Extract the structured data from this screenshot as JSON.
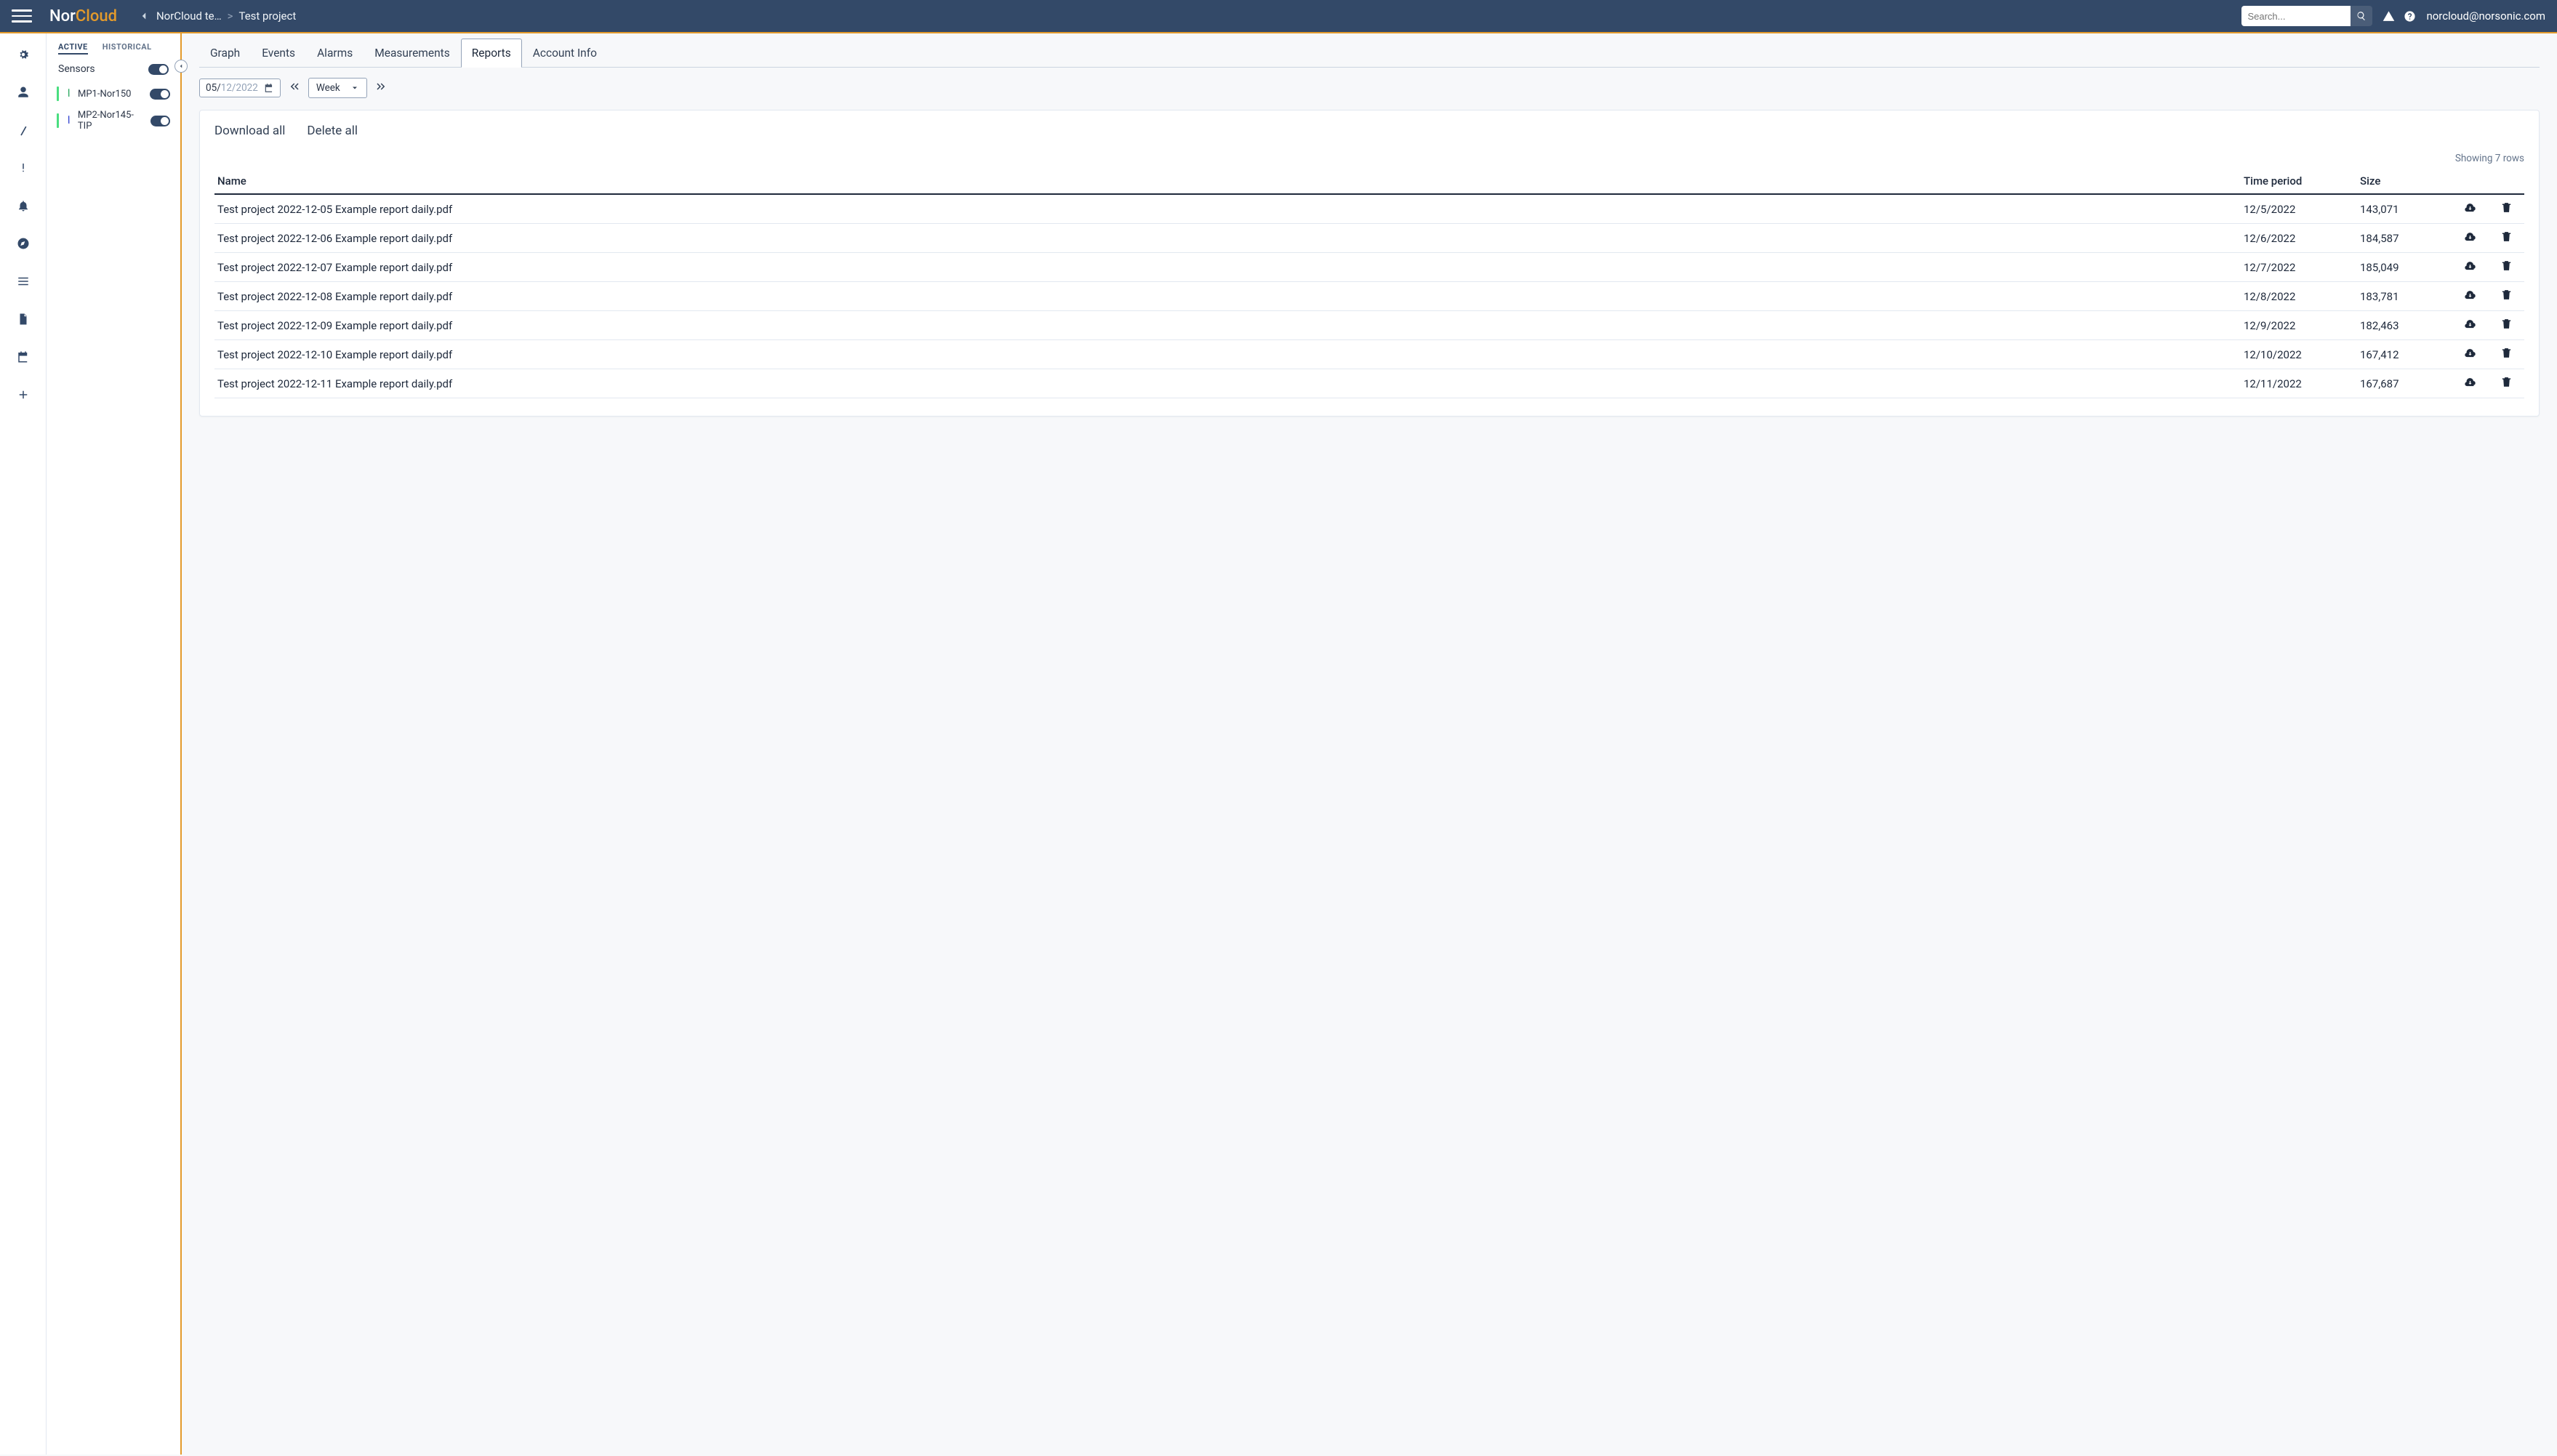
{
  "header": {
    "brand_prefix": "Nor",
    "brand_suffix": "Cloud",
    "breadcrumb_org": "NorCloud te…",
    "breadcrumb_project": "Test project",
    "search_placeholder": "Search...",
    "user_email": "norcloud@norsonic.com"
  },
  "sidebar": {
    "tab_active": "ACTIVE",
    "tab_historical": "HISTORICAL",
    "sensors_label": "Sensors",
    "items": [
      {
        "label": "MP1-Nor150"
      },
      {
        "label": "MP2-Nor145-TIP"
      }
    ]
  },
  "tabs": {
    "graph": "Graph",
    "events": "Events",
    "alarms": "Alarms",
    "measurements": "Measurements",
    "reports": "Reports",
    "account": "Account Info"
  },
  "controls": {
    "date_day": "05/",
    "date_rest": "12/2022",
    "period_label": "Week"
  },
  "card": {
    "download_all": "Download all",
    "delete_all": "Delete all",
    "rowcount": "Showing 7 rows",
    "columns": {
      "name": "Name",
      "time": "Time period",
      "size": "Size"
    },
    "rows": [
      {
        "name": "Test project 2022-12-05 Example report daily.pdf",
        "time": "12/5/2022",
        "size": "143,071"
      },
      {
        "name": "Test project 2022-12-06 Example report daily.pdf",
        "time": "12/6/2022",
        "size": "184,587"
      },
      {
        "name": "Test project 2022-12-07 Example report daily.pdf",
        "time": "12/7/2022",
        "size": "185,049"
      },
      {
        "name": "Test project 2022-12-08 Example report daily.pdf",
        "time": "12/8/2022",
        "size": "183,781"
      },
      {
        "name": "Test project 2022-12-09 Example report daily.pdf",
        "time": "12/9/2022",
        "size": "182,463"
      },
      {
        "name": "Test project 2022-12-10 Example report daily.pdf",
        "time": "12/10/2022",
        "size": "167,412"
      },
      {
        "name": "Test project 2022-12-11 Example report daily.pdf",
        "time": "12/11/2022",
        "size": "167,687"
      }
    ]
  }
}
